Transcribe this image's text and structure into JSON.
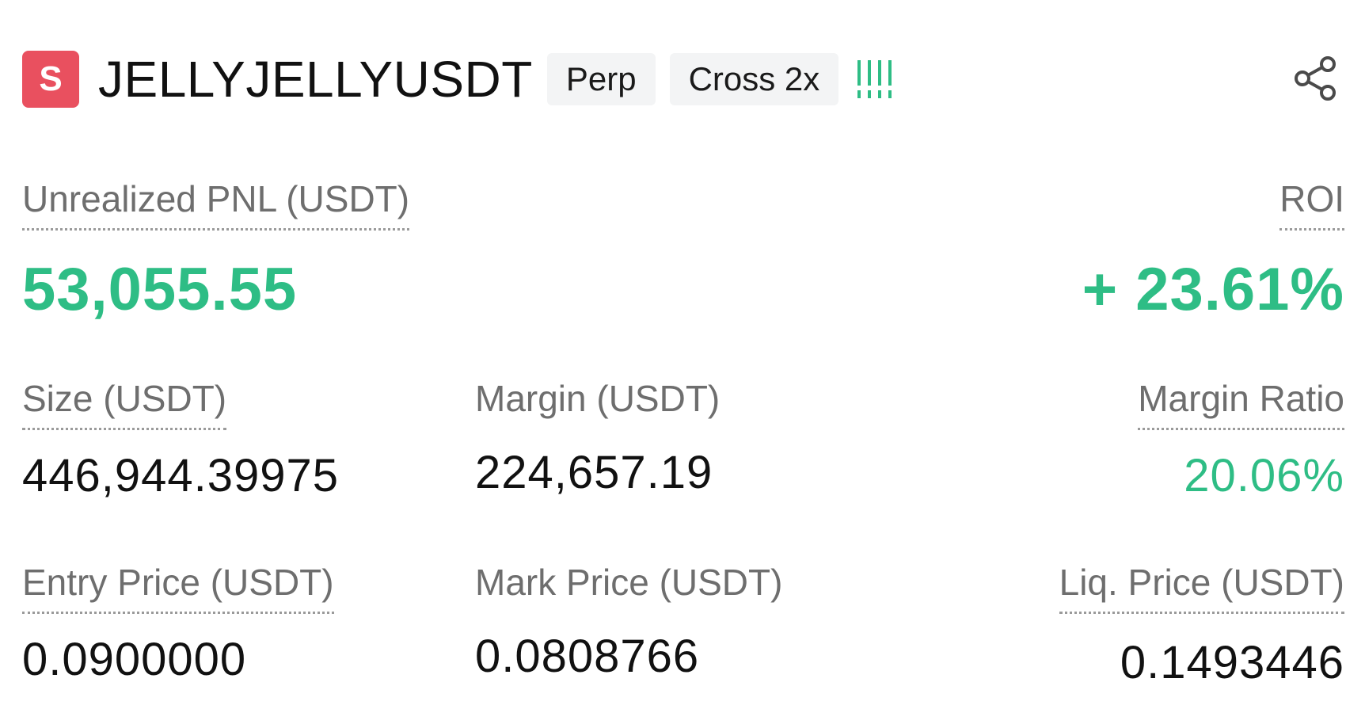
{
  "header": {
    "side_badge": "S",
    "symbol": "JELLYJELLYUSDT",
    "tags": [
      "Perp",
      "Cross 2x"
    ],
    "risk_indicator_color": "#2ebd85",
    "share_icon": "share-icon"
  },
  "position": {
    "unrealized_pnl_label": "Unrealized PNL (USDT)",
    "unrealized_pnl_value": "53,055.55",
    "roi_label": "ROI",
    "roi_value": "+ 23.61%",
    "size_label": "Size (USDT)",
    "size_value": "446,944.39975",
    "margin_label": "Margin (USDT)",
    "margin_value": "224,657.19",
    "margin_ratio_label": "Margin Ratio",
    "margin_ratio_value": "20.06%",
    "entry_price_label": "Entry Price (USDT)",
    "entry_price_value": "0.0900000",
    "mark_price_label": "Mark Price (USDT)",
    "mark_price_value": "0.0808766",
    "liq_price_label": "Liq. Price (USDT)",
    "liq_price_value": "0.1493446"
  },
  "colors": {
    "profit_green": "#2ebd85",
    "short_badge_red": "#e9505f",
    "label_gray": "#6e6e6e",
    "tag_bg": "#f3f4f5"
  }
}
